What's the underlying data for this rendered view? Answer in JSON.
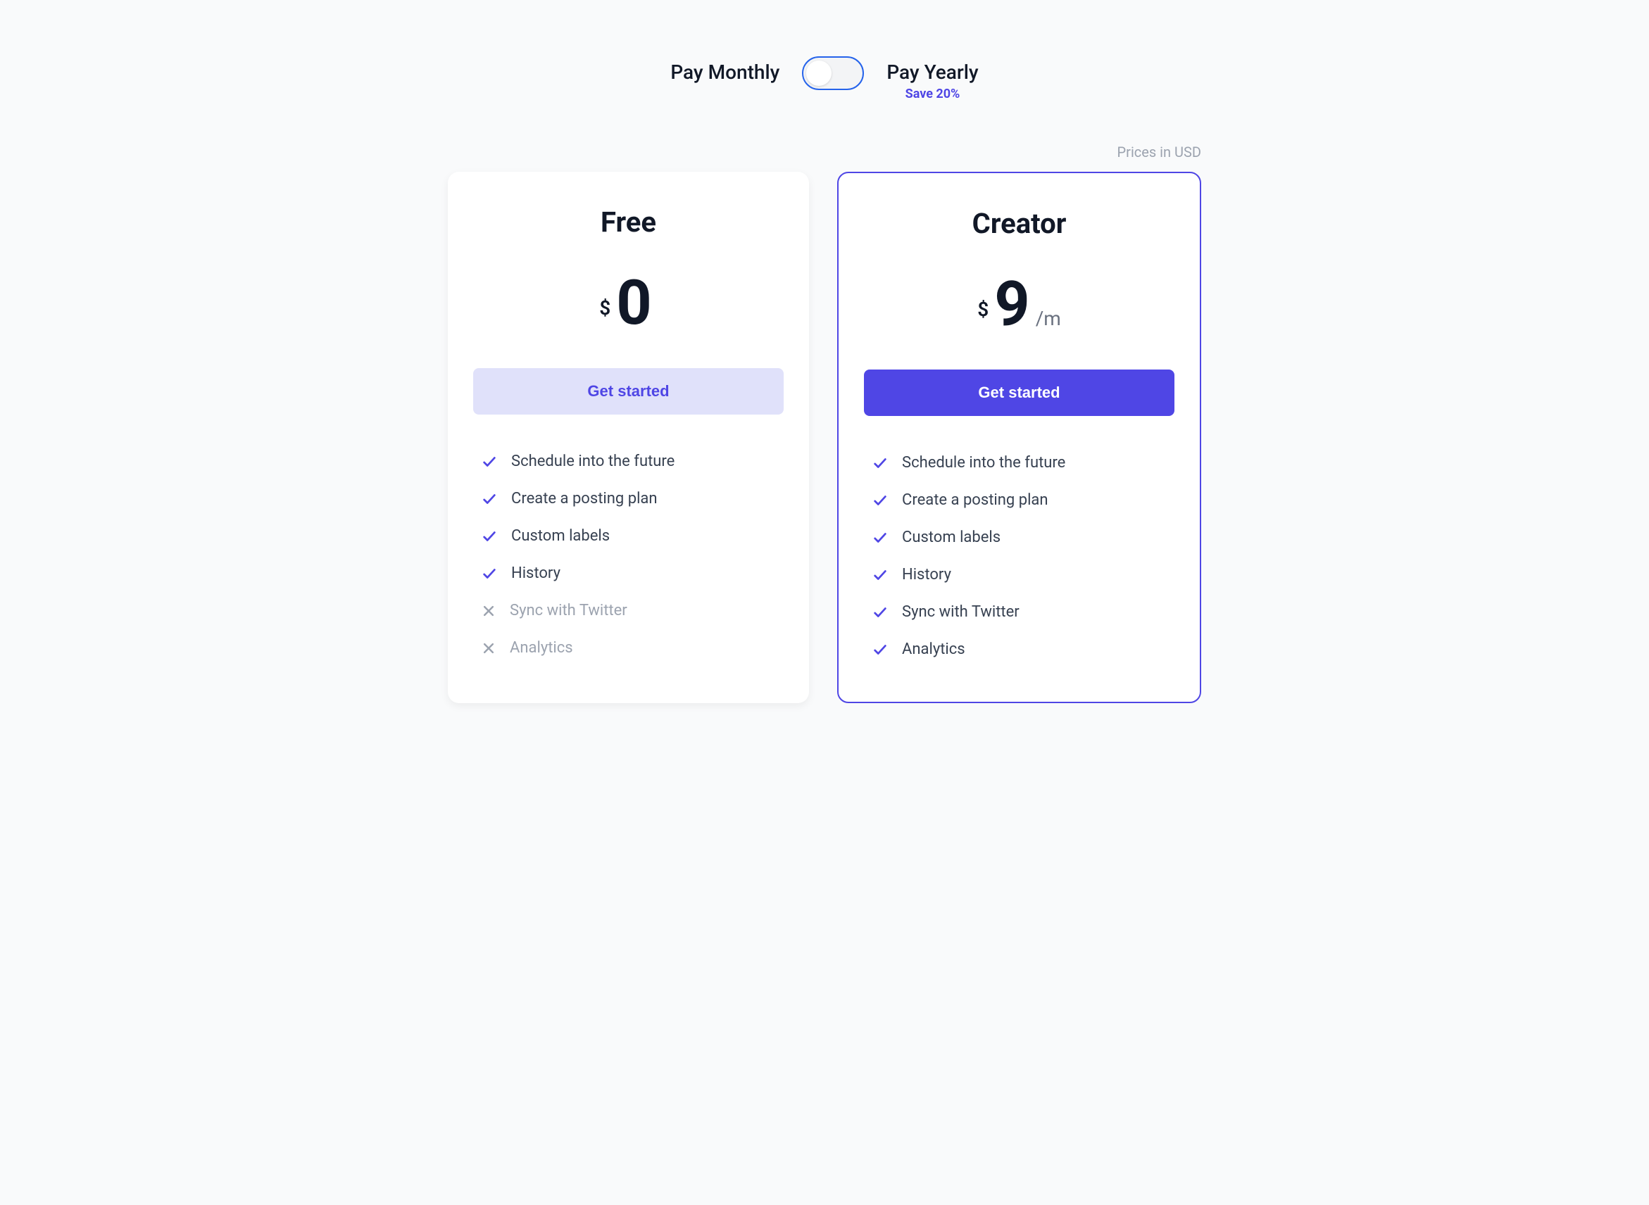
{
  "billing_toggle": {
    "monthly_label": "Pay Monthly",
    "yearly_label": "Pay Yearly",
    "save_text": "Save 20%"
  },
  "currency_note": "Prices in USD",
  "plans": [
    {
      "name": "Free",
      "currency": "$",
      "price": "0",
      "period": "",
      "cta": "Get started",
      "features": [
        {
          "included": true,
          "label": "Schedule into the future"
        },
        {
          "included": true,
          "label": "Create a posting plan"
        },
        {
          "included": true,
          "label": "Custom labels"
        },
        {
          "included": true,
          "label": "History"
        },
        {
          "included": false,
          "label": "Sync with Twitter"
        },
        {
          "included": false,
          "label": "Analytics"
        }
      ]
    },
    {
      "name": "Creator",
      "currency": "$",
      "price": "9",
      "period": "/m",
      "cta": "Get started",
      "features": [
        {
          "included": true,
          "label": "Schedule into the future"
        },
        {
          "included": true,
          "label": "Create a posting plan"
        },
        {
          "included": true,
          "label": "Custom labels"
        },
        {
          "included": true,
          "label": "History"
        },
        {
          "included": true,
          "label": "Sync with Twitter"
        },
        {
          "included": true,
          "label": "Analytics"
        }
      ]
    }
  ]
}
